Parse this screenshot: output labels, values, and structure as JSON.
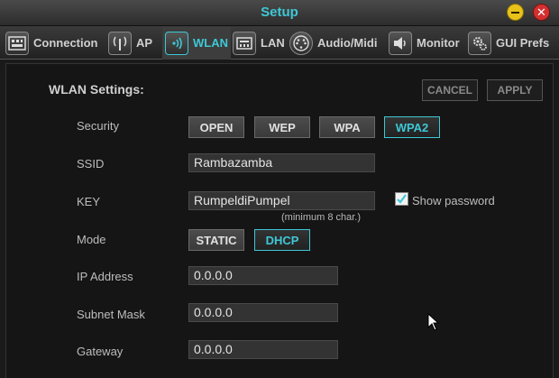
{
  "window": {
    "title": "Setup"
  },
  "tabs": [
    {
      "label": "Connection",
      "icon": "connection-icon"
    },
    {
      "label": "AP",
      "icon": "access-point-icon"
    },
    {
      "label": "WLAN",
      "icon": "wifi-icon",
      "active": true
    },
    {
      "label": "LAN",
      "icon": "ethernet-icon"
    },
    {
      "label": "Audio/Midi",
      "icon": "midi-icon"
    },
    {
      "label": "Monitor",
      "icon": "speaker-icon"
    },
    {
      "label": "GUI Prefs",
      "icon": "gears-icon"
    }
  ],
  "wlan": {
    "heading": "WLAN Settings:",
    "cancel_label": "CANCEL",
    "apply_label": "APPLY",
    "security": {
      "label": "Security",
      "options": [
        "OPEN",
        "WEP",
        "WPA",
        "WPA2"
      ],
      "selected": "WPA2"
    },
    "ssid": {
      "label": "SSID",
      "value": "Rambazamba"
    },
    "key": {
      "label": "KEY",
      "value": "RumpeldiPumpel",
      "hint": "(minimum 8 char.)"
    },
    "show_password": {
      "label": "Show password",
      "checked": true
    },
    "mode": {
      "label": "Mode",
      "options": [
        "STATIC",
        "DHCP"
      ],
      "selected": "DHCP"
    },
    "ip": {
      "label": "IP Address",
      "value": "0.0.0.0"
    },
    "subnet": {
      "label": "Subnet Mask",
      "value": "0.0.0.0"
    },
    "gateway": {
      "label": "Gateway",
      "value": "0.0.0.0"
    }
  },
  "colors": {
    "accent": "#3ec8d6",
    "background": "#151515",
    "button": "#444444"
  }
}
